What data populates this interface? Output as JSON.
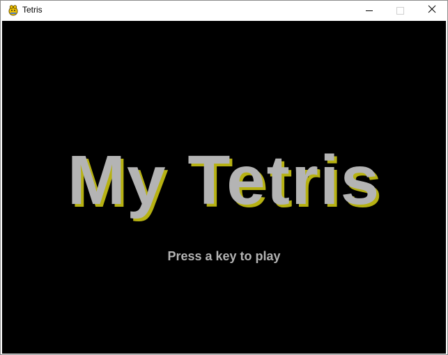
{
  "window": {
    "title": "Tetris",
    "icon": "pygame-snake-icon",
    "controls": {
      "minimize": "minimize-icon",
      "maximize": "maximize-icon",
      "close": "close-icon",
      "close_glyph": "✕"
    }
  },
  "game": {
    "title": "My Tetris",
    "prompt": "Press a key to play",
    "colors": {
      "background": "#000000",
      "title_text": "#b4b4b4",
      "title_shadow": "#b6b112",
      "prompt_text": "#b4b4b4"
    }
  }
}
